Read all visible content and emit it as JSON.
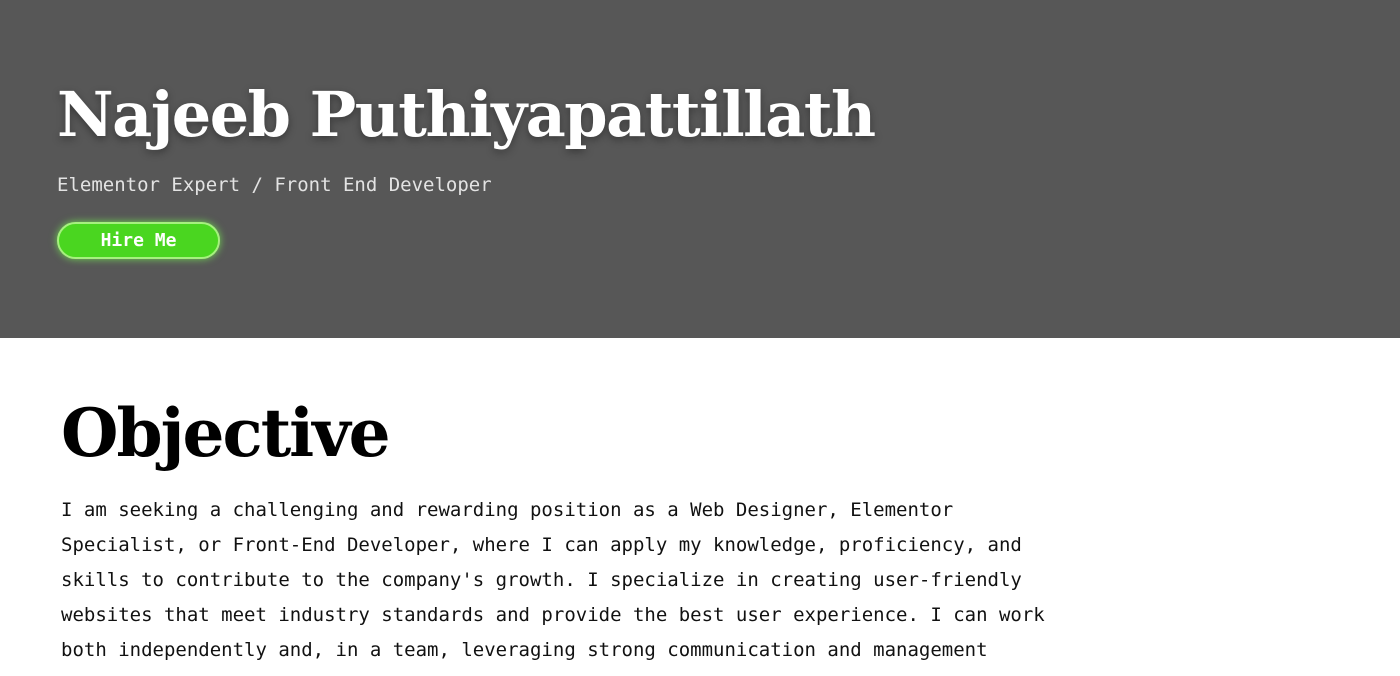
{
  "hero": {
    "name": "Najeeb Puthiyapattillath",
    "subtitle": "Elementor Expert / Front End Developer",
    "button_label": "Hire Me"
  },
  "objective": {
    "title": "Objective",
    "lines": [
      "I am seeking a challenging and rewarding position as a Web Designer, Elementor",
      "Specialist, or Front-End Developer, where I can apply my knowledge, proficiency, and",
      "skills to contribute to the company's growth. I specialize in creating user-friendly",
      "websites that meet industry standards and provide the best user experience. I can work",
      "both independently and, in a team, leveraging strong communication and management"
    ]
  },
  "colors": {
    "hero_background": "#575757",
    "button_background": "#4ad620",
    "button_border": "#a6f07f"
  }
}
